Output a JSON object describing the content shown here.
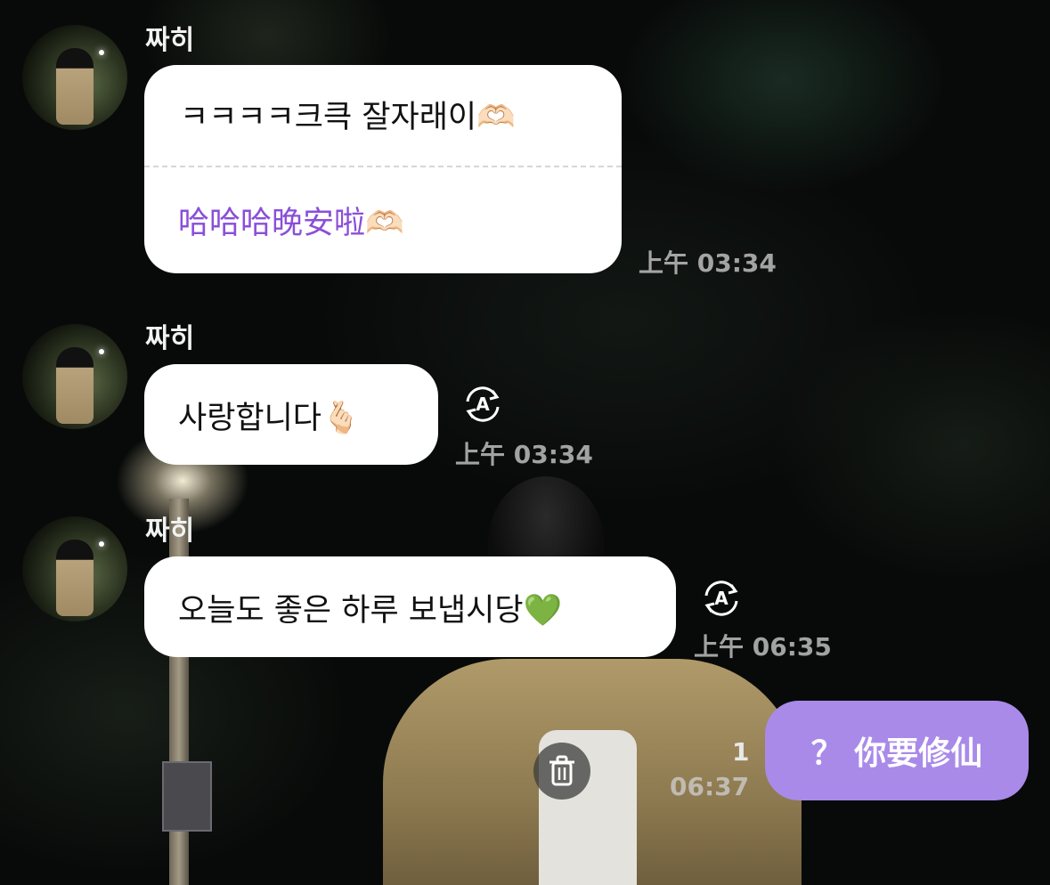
{
  "conversation": {
    "messages": [
      {
        "sender": "짜히",
        "lines": [
          "ㅋㅋㅋㅋ크큭 잘자래이🫶🏻"
        ],
        "translation": "哈哈哈晚安啦🫶🏻",
        "time": "上午 03:34"
      },
      {
        "sender": "짜히",
        "text": "사랑합니다🫰🏻",
        "time": "上午 03:34"
      },
      {
        "sender": "짜히",
        "text": "오늘도 좋은 하루 보냅시당💚",
        "time": "上午 06:35"
      }
    ],
    "outgoing": {
      "text": "？ 你要修仙",
      "read_count": "1",
      "time": "06:37"
    }
  },
  "icons": {
    "translate": "auto-translate-icon",
    "delete": "trash-icon"
  },
  "colors": {
    "outgoing_bubble": "#a98ae9",
    "translation_text": "#8a4fd8",
    "incoming_bubble": "#ffffff"
  }
}
